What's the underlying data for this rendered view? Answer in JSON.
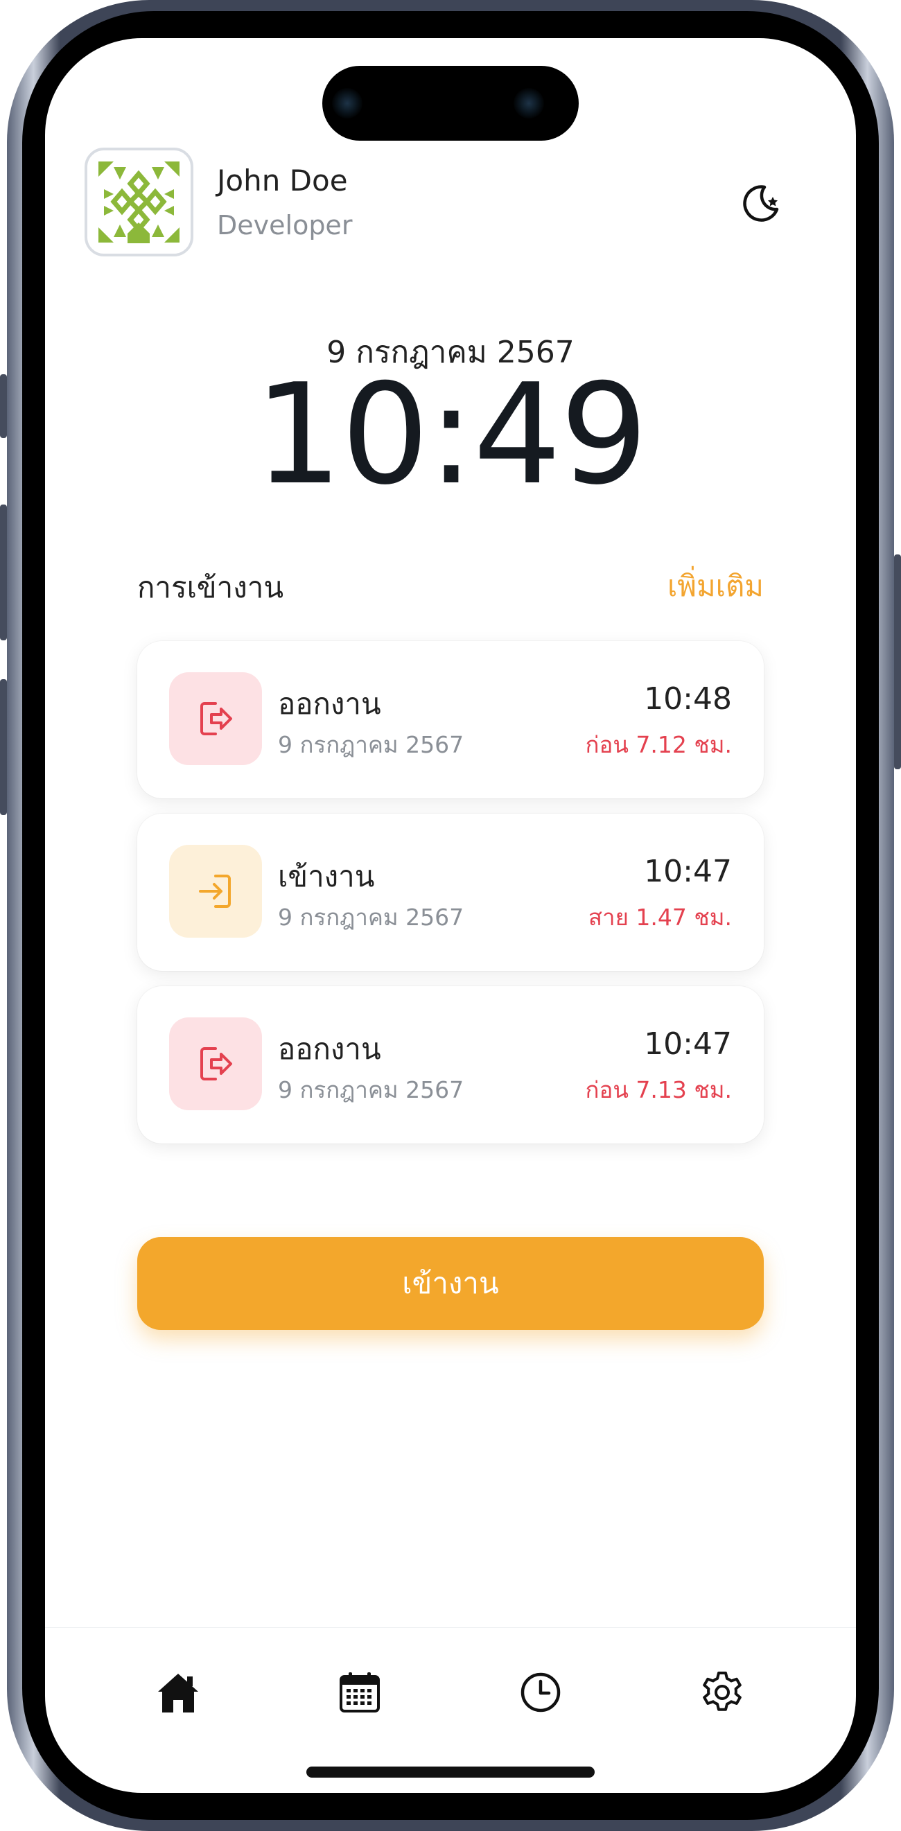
{
  "user": {
    "name": "John Doe",
    "role": "Developer"
  },
  "today": {
    "date": "9 กรกฎาคม 2567",
    "time": "10:49"
  },
  "attendance": {
    "title": "การเข้างาน",
    "more_label": "เพิ่มเติม",
    "items": [
      {
        "type": "ออกงาน",
        "date": "9 กรกฎาคม 2567",
        "time": "10:48",
        "diff": "ก่อน 7.12 ชม.",
        "icon": "logout-icon"
      },
      {
        "type": "เข้างาน",
        "date": "9 กรกฎาคม 2567",
        "time": "10:47",
        "diff": "สาย 1.47 ชม.",
        "icon": "login-icon"
      },
      {
        "type": "ออกงาน",
        "date": "9 กรกฎาคม 2567",
        "time": "10:47",
        "diff": "ก่อน 7.13 ชม.",
        "icon": "logout-icon"
      }
    ]
  },
  "action_button": {
    "label": "เข้างาน"
  },
  "tabbar": {
    "tabs": [
      "home-icon",
      "calendar-icon",
      "clock-icon",
      "gear-icon"
    ]
  },
  "colors": {
    "accent": "#f3a72c",
    "danger": "#e4414f",
    "out_bg": "#fde1e4",
    "in_bg": "#fdf0d9"
  }
}
